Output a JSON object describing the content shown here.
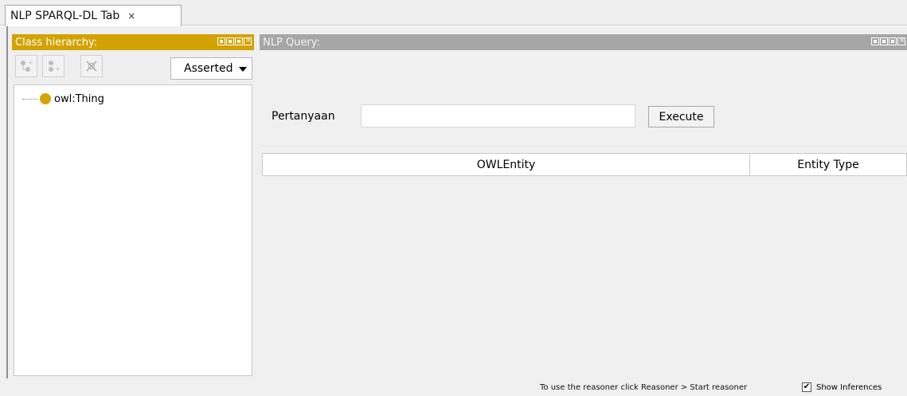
{
  "tab": {
    "label": "NLP SPARQL-DL Tab",
    "close": "×"
  },
  "class_hierarchy": {
    "title": "Class hierarchy:",
    "mode_select": "Asserted",
    "toolbar_icons": [
      "add-subclass-icon",
      "add-sibling-icon",
      "delete-class-icon"
    ],
    "tree": [
      {
        "label": "owl:Thing",
        "icon": "class-dot-icon",
        "color": "#d2a600"
      }
    ],
    "header_color": "#d2a300"
  },
  "nlp_query": {
    "title": "NLP Query:",
    "question_label": "Pertanyaan",
    "question_value": "",
    "execute_label": "Execute",
    "columns": [
      "OWLEntity",
      "Entity Type"
    ],
    "header_color": "#a6a6a6"
  },
  "status": {
    "message": "To use the reasoner click Reasoner > Start reasoner",
    "show_inferences_label": "Show Inferences",
    "show_inferences_checked": true
  }
}
